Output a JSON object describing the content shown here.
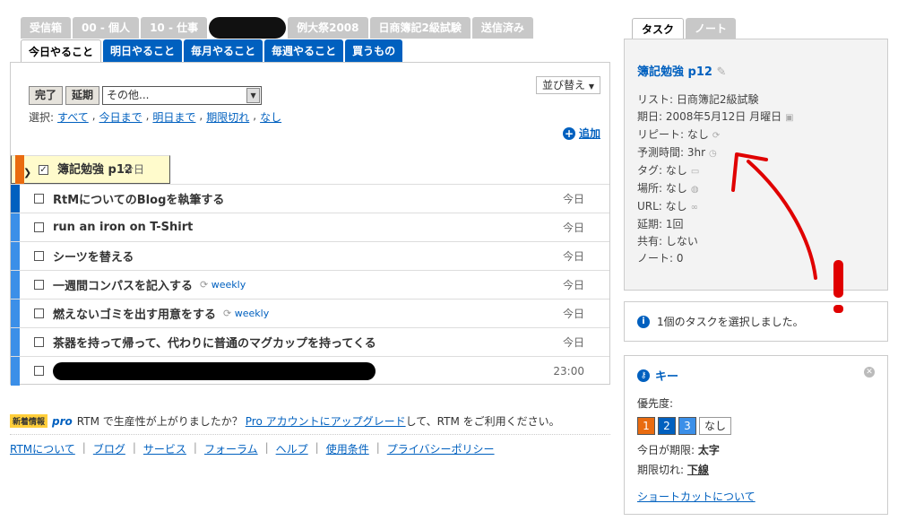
{
  "top_tabs": [
    "受信箱",
    "00 - 個人",
    "10 - 仕事",
    "",
    "例大祭2008",
    "日商簿記2級試験",
    "送信済み"
  ],
  "list_tabs": [
    "今日やること",
    "明日やること",
    "毎月やること",
    "毎週やること",
    "買うもの"
  ],
  "toolbar": {
    "complete": "完了",
    "postpone": "延期",
    "more_actions": "その他...",
    "sort": "並び替え"
  },
  "select": {
    "label": "選択:",
    "links": [
      "すべて",
      "今日まで",
      "明日まで",
      "期限切れ",
      "なし"
    ]
  },
  "add_label": "追加",
  "tasks": [
    {
      "name": "簿記勉強 p12",
      "due": "今日",
      "repeat": ""
    },
    {
      "name": "RtMについてのBlogを執筆する",
      "due": "今日",
      "repeat": ""
    },
    {
      "name": "run an iron on T-Shirt",
      "due": "今日",
      "repeat": ""
    },
    {
      "name": "シーツを替える",
      "due": "今日",
      "repeat": ""
    },
    {
      "name": "一週間コンパスを記入する",
      "due": "今日",
      "repeat": "weekly"
    },
    {
      "name": "燃えないゴミを出す用意をする",
      "due": "今日",
      "repeat": "weekly"
    },
    {
      "name": "茶器を持って帰って、代わりに普通のマグカップを持ってくる",
      "due": "今日",
      "repeat": ""
    },
    {
      "name": "",
      "due": "23:00",
      "repeat": ""
    }
  ],
  "news": {
    "tag": "新着情報",
    "pro": "pro",
    "text1": "RTM で生産性が上がりましたか？",
    "link": "Pro アカウントにアップグレード",
    "text2": "して、RTM をご利用ください。"
  },
  "footer": [
    "RTMについて",
    "ブログ",
    "サービス",
    "フォーラム",
    "ヘルプ",
    "使用条件",
    "プライバシーポリシー"
  ],
  "right_tabs": [
    "タスク",
    "ノート"
  ],
  "detail": {
    "title": "簿記勉強 p12",
    "list": "リスト: 日商簿記2級試験",
    "due": "期日: 2008年5月12日 月曜日",
    "repeat": "リピート: なし",
    "estimate": "予測時間: 3hr",
    "tags": "タグ: なし",
    "location": "場所: なし",
    "url": "URL: なし",
    "postponed": "延期: 1回",
    "shared": "共有: しない",
    "notes": "ノート: 0"
  },
  "info": "1個のタスクを選択しました。",
  "keybox": {
    "title": "キー",
    "priority_label": "優先度:",
    "pri1": "1",
    "pri2": "2",
    "pri3": "3",
    "prinone": "なし",
    "due_today_prefix": "今日が期限:",
    "due_today_value": "太字",
    "overdue_prefix": "期限切れ:",
    "overdue_value": "下線",
    "shortcut_link": "ショートカットについて"
  },
  "colors": {
    "accent": "#0060bf",
    "priority1": "#e96b10",
    "priority2": "#0060bf",
    "priority3": "#3b8fe8",
    "annotation": "#e00000"
  }
}
